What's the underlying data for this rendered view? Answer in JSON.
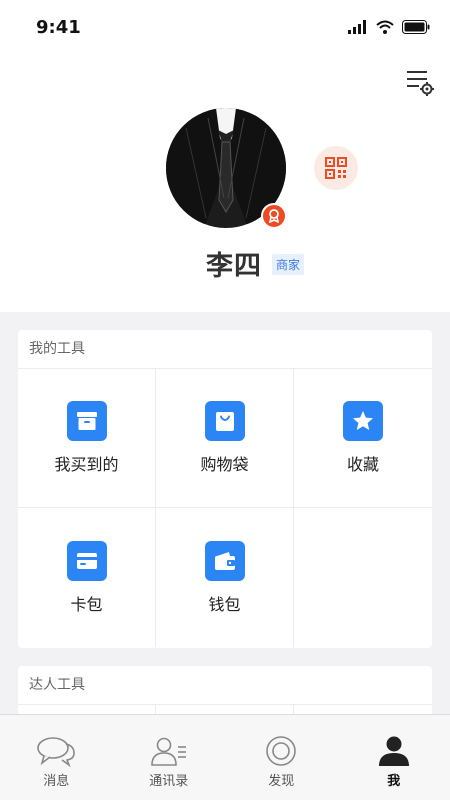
{
  "status_bar": {
    "time": "9:41"
  },
  "profile": {
    "name": "李四",
    "tag": "商家"
  },
  "tools": {
    "title": "我的工具",
    "items": [
      {
        "label": "我买到的",
        "icon": "purchased-box-icon"
      },
      {
        "label": "购物袋",
        "icon": "shopping-bag-icon"
      },
      {
        "label": "收藏",
        "icon": "star-icon"
      },
      {
        "label": "卡包",
        "icon": "card-wallet-icon"
      },
      {
        "label": "钱包",
        "icon": "wallet-icon"
      }
    ]
  },
  "expert_tools": {
    "title": "达人工具"
  },
  "tab_bar": {
    "active": "我",
    "tabs": [
      {
        "label": "消息",
        "icon": "chat-bubbles-icon"
      },
      {
        "label": "通讯录",
        "icon": "contacts-icon"
      },
      {
        "label": "发现",
        "icon": "discover-icon"
      },
      {
        "label": "我",
        "icon": "person-icon"
      }
    ]
  },
  "colors": {
    "accent": "#2c85f5",
    "badge": "#ee4b24",
    "qr_bg": "#fbe9e4",
    "tag_text": "#3b78e7"
  }
}
